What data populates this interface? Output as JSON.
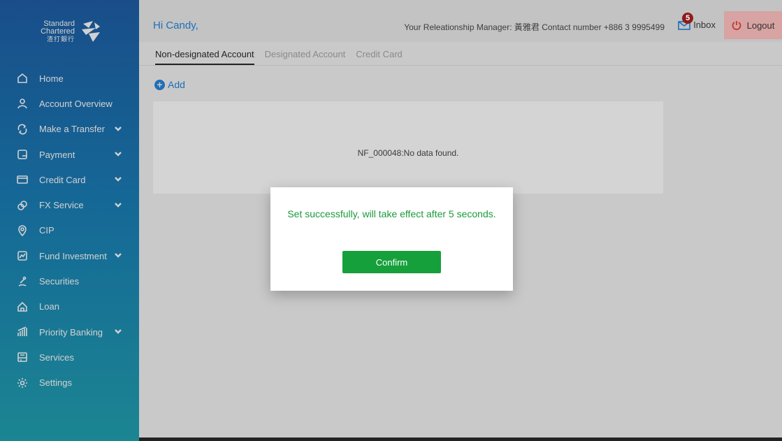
{
  "brand": {
    "logo_line1": "Standard",
    "logo_line2": "Chartered",
    "logo_line3": "渣打銀行"
  },
  "sidebar": {
    "items": [
      {
        "label": "Home",
        "icon": "home-icon",
        "expandable": false
      },
      {
        "label": "Account Overview",
        "icon": "user-icon",
        "expandable": false
      },
      {
        "label": "Make a Transfer",
        "icon": "transfer-icon",
        "expandable": true
      },
      {
        "label": "Payment",
        "icon": "payment-icon",
        "expandable": true
      },
      {
        "label": "Credit Card",
        "icon": "credit-card-icon",
        "expandable": true
      },
      {
        "label": "FX Service",
        "icon": "fx-icon",
        "expandable": true
      },
      {
        "label": "CIP",
        "icon": "cip-icon",
        "expandable": false
      },
      {
        "label": "Fund Investment",
        "icon": "fund-icon",
        "expandable": true
      },
      {
        "label": "Securities",
        "icon": "securities-icon",
        "expandable": false
      },
      {
        "label": "Loan",
        "icon": "loan-icon",
        "expandable": false
      },
      {
        "label": "Priority Banking",
        "icon": "priority-banking-icon",
        "expandable": true
      },
      {
        "label": "Services",
        "icon": "services-icon",
        "expandable": false
      },
      {
        "label": "Settings",
        "icon": "settings-icon",
        "expandable": false
      }
    ]
  },
  "header": {
    "greeting": "Hi Candy,",
    "relationship_manager": "Your Releationship Manager: 黃雅君 Contact number +886 3 9995499",
    "inbox_label": "Inbox",
    "inbox_count": "5",
    "logout_label": "Logout"
  },
  "tabs": [
    {
      "label": "Non-designated Account",
      "active": true
    },
    {
      "label": "Designated Account",
      "active": false
    },
    {
      "label": "Credit Card",
      "active": false
    }
  ],
  "main": {
    "add_label": "Add",
    "empty_message": "NF_000048:No data found."
  },
  "modal": {
    "message": "Set successfully, will take effect after 5 seconds.",
    "confirm_label": "Confirm"
  },
  "colors": {
    "accent": "#1e6fb8",
    "success": "#16a03c",
    "badge": "#8e1c1c"
  }
}
